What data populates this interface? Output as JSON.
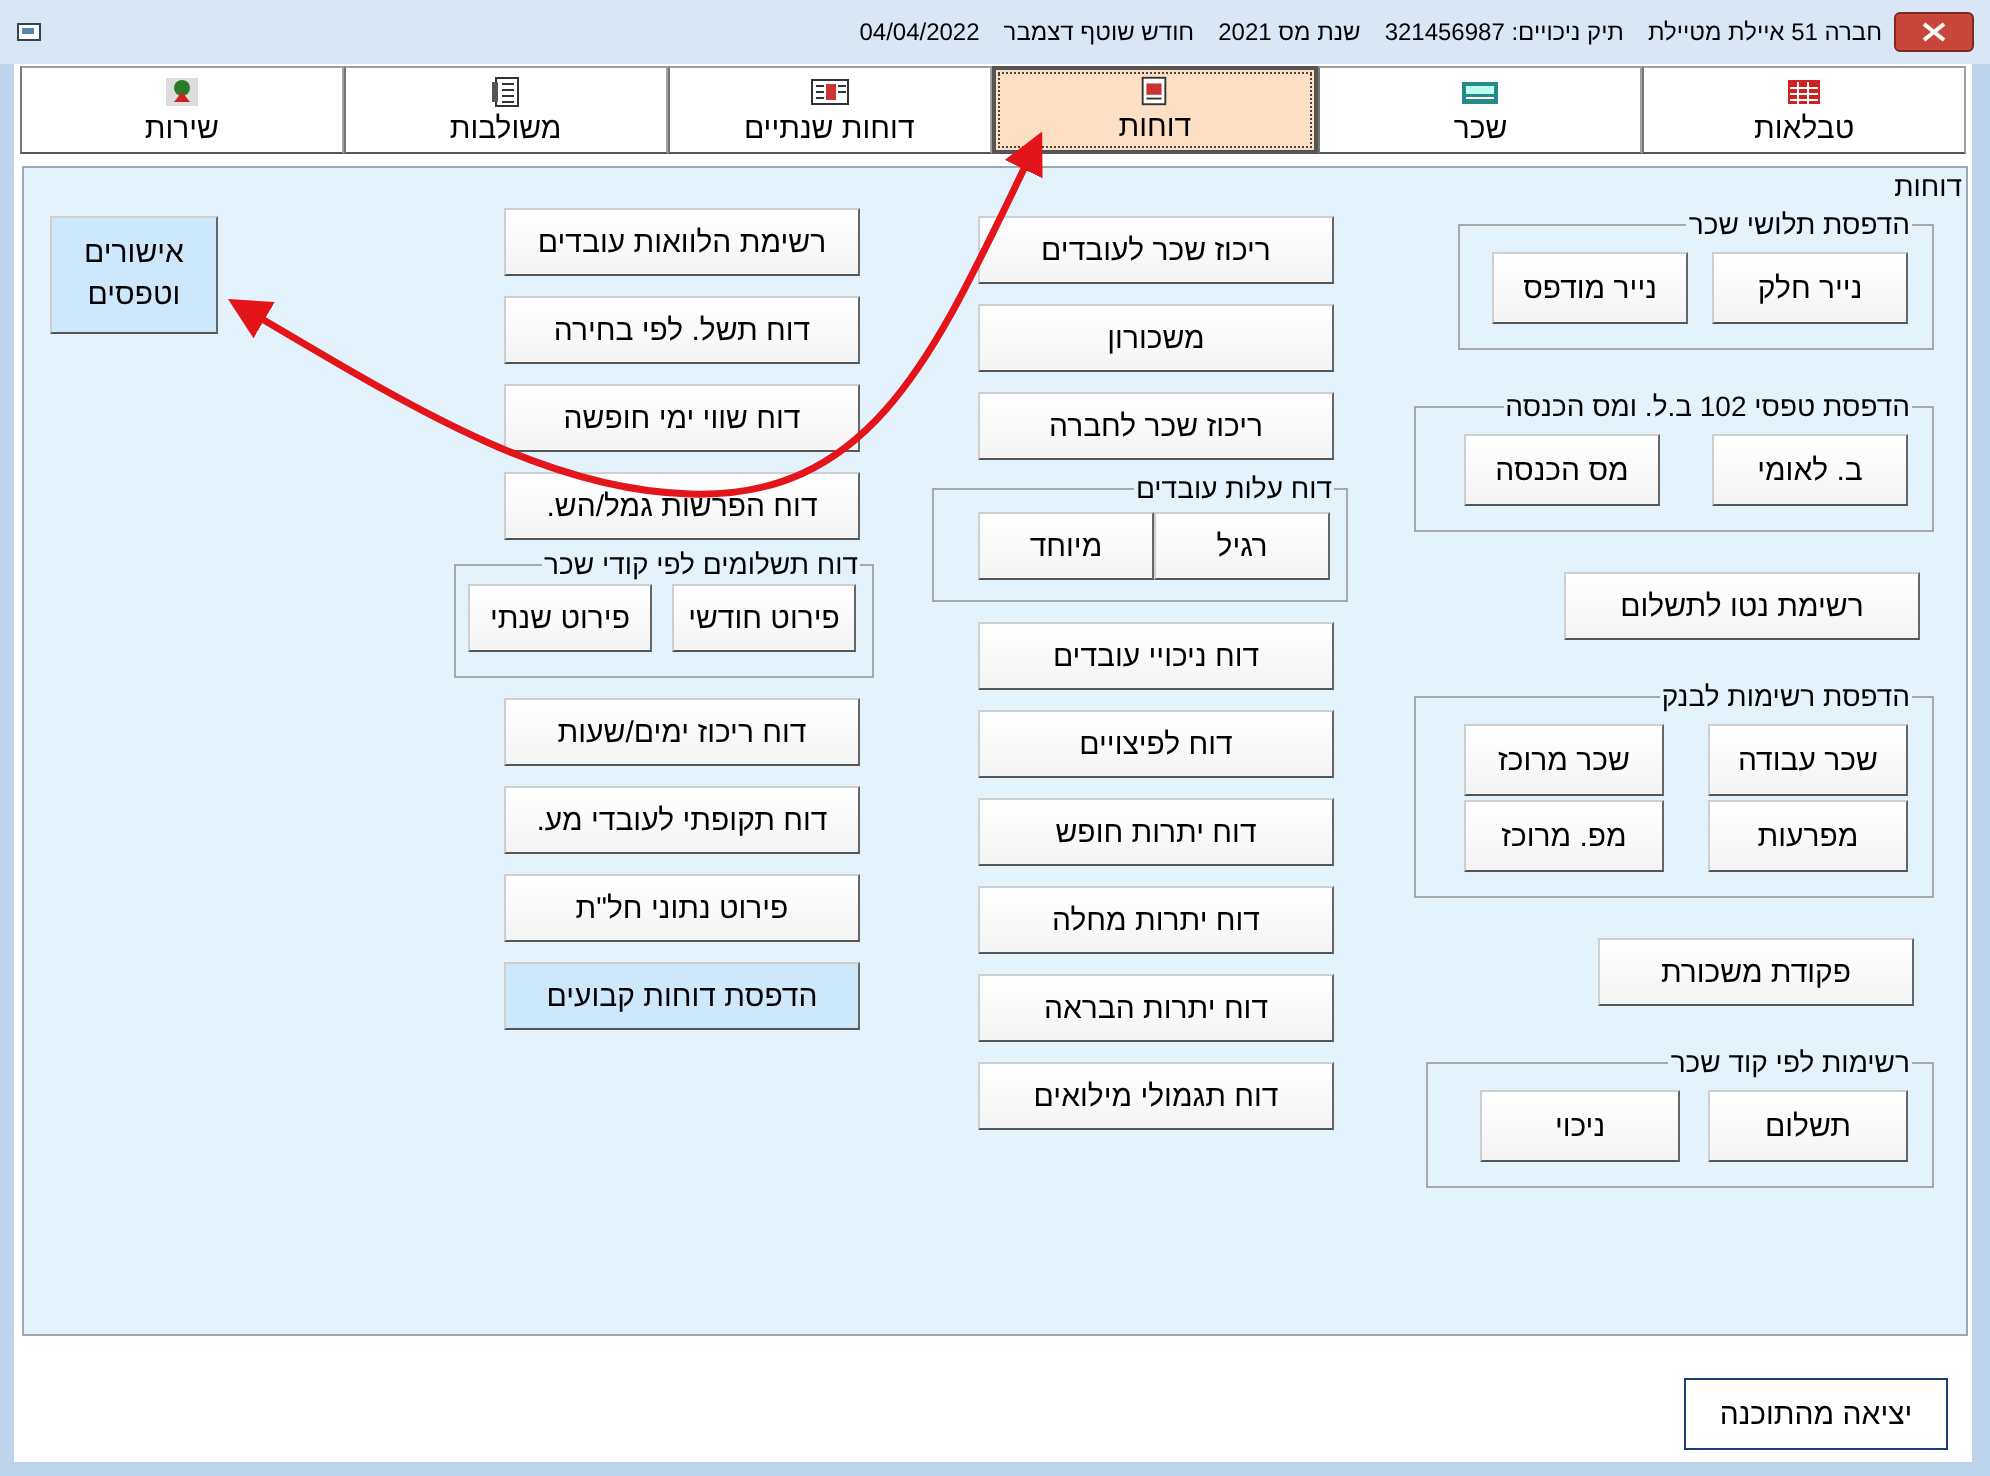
{
  "window": {
    "title_items": [
      "חברה 51 איילת מטיילת",
      "תיק ניכויים: 321456987",
      "שנת מס 2021",
      "חודש שוטף דצמבר",
      "04/04/2022"
    ]
  },
  "tabs": [
    {
      "label": "טבלאות",
      "selected": false
    },
    {
      "label": "שכר",
      "selected": false
    },
    {
      "label": "דוחות",
      "selected": true
    },
    {
      "label": "דוחות שנתיים",
      "selected": false
    },
    {
      "label": "משולבות",
      "selected": false
    },
    {
      "label": "שירות",
      "selected": false
    }
  ],
  "panel": {
    "title": "דוחות",
    "columns": [
      {
        "items": [
          {
            "kind": "group",
            "title": "הדפסת תלושי שכר",
            "buttons": [
              {
                "label": "נייר חלק",
                "highlighted": false
              },
              {
                "label": "נייר מודפס",
                "highlighted": false
              }
            ]
          },
          {
            "kind": "group",
            "title": "הדפסת טפסי 102 ב.ל. ומס הכנסה",
            "buttons": [
              {
                "label": "ב. לאומי",
                "highlighted": false
              },
              {
                "label": "מס הכנסה",
                "highlighted": false
              }
            ]
          },
          {
            "kind": "button",
            "label": "רשימת נטו לתשלום",
            "highlighted": false
          },
          {
            "kind": "group",
            "title": "הדפסת רשימות לבנק",
            "buttons": [
              {
                "label": "שכר עבודה",
                "highlighted": false
              },
              {
                "label": "שכר מרוכז",
                "highlighted": false
              },
              {
                "label": "מפרעות",
                "highlighted": false
              },
              {
                "label": "מפ. מרוכז",
                "highlighted": false
              }
            ]
          },
          {
            "kind": "button",
            "label": "פקודת משכורת",
            "highlighted": false
          },
          {
            "kind": "group",
            "title": "רשימות לפי קוד שכר",
            "buttons": [
              {
                "label": "תשלום",
                "highlighted": false
              },
              {
                "label": "ניכוי",
                "highlighted": false
              }
            ]
          }
        ]
      },
      {
        "items": [
          {
            "kind": "button",
            "label": "ריכוז שכר לעובדים",
            "highlighted": false
          },
          {
            "kind": "button",
            "label": "משכורון",
            "highlighted": false
          },
          {
            "kind": "button",
            "label": "ריכוז שכר לחברה",
            "highlighted": false
          },
          {
            "kind": "group",
            "title": "דוח עלות עובדים",
            "buttons": [
              {
                "label": "רגיל",
                "highlighted": false
              },
              {
                "label": "מיוחד",
                "highlighted": false
              }
            ]
          },
          {
            "kind": "button",
            "label": "דוח ניכויי עובדים",
            "highlighted": false
          },
          {
            "kind": "button",
            "label": "דוח לפיצויים",
            "highlighted": false
          },
          {
            "kind": "button",
            "label": "דוח יתרות חופש",
            "highlighted": false
          },
          {
            "kind": "button",
            "label": "דוח יתרות מחלה",
            "highlighted": false
          },
          {
            "kind": "button",
            "label": "דוח יתרות הבראה",
            "highlighted": false
          },
          {
            "kind": "button",
            "label": "דוח תגמולי מילואים",
            "highlighted": false
          }
        ]
      },
      {
        "items": [
          {
            "kind": "button",
            "label": "רשימת הלוואות עובדים",
            "highlighted": false
          },
          {
            "kind": "button",
            "label": "דוח תשל. לפי בחירה",
            "highlighted": false
          },
          {
            "kind": "button",
            "label": "דוח שווי ימי חופשה",
            "highlighted": false
          },
          {
            "kind": "button",
            "label": "דוח הפרשות גמל/הש.",
            "highlighted": false
          },
          {
            "kind": "group",
            "title": "דוח תשלומים לפי קודי שכר",
            "buttons": [
              {
                "label": "פירוט חודשי",
                "highlighted": false
              },
              {
                "label": "פירוט שנתי",
                "highlighted": false
              }
            ]
          },
          {
            "kind": "button",
            "label": "דוח ריכוז ימים/שעות",
            "highlighted": false
          },
          {
            "kind": "button",
            "label": "דוח תקופתי לעובדי מע.",
            "highlighted": false
          },
          {
            "kind": "button",
            "label": "פירוט נתוני חל\"ת",
            "highlighted": false
          },
          {
            "kind": "button",
            "label": "הדפסת דוחות קבועים",
            "highlighted": true
          }
        ]
      },
      {
        "items": [
          {
            "kind": "big",
            "label": "אישורים וטפסים",
            "highlighted": true
          }
        ]
      }
    ]
  },
  "exit_button": {
    "label": "יציאה מהתוכנה"
  }
}
